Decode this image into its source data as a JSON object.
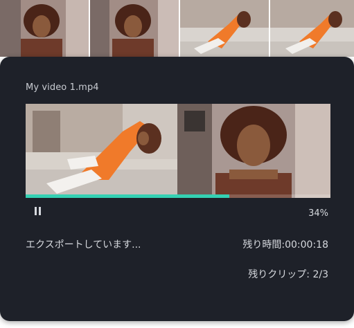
{
  "dialog": {
    "file_name": "My video 1.mp4",
    "progress_percent_label": "34%",
    "progress": 0.34,
    "status_text": "エクスポートしています...",
    "remaining_time": "残り時間:00:00:18",
    "remaining_clips": "残りクリップ: 2/3",
    "pause_icon": "pause-icon"
  },
  "colors": {
    "dialog_bg": "#1e2129",
    "accent": "#34d1b3",
    "text": "#d6d9de"
  }
}
